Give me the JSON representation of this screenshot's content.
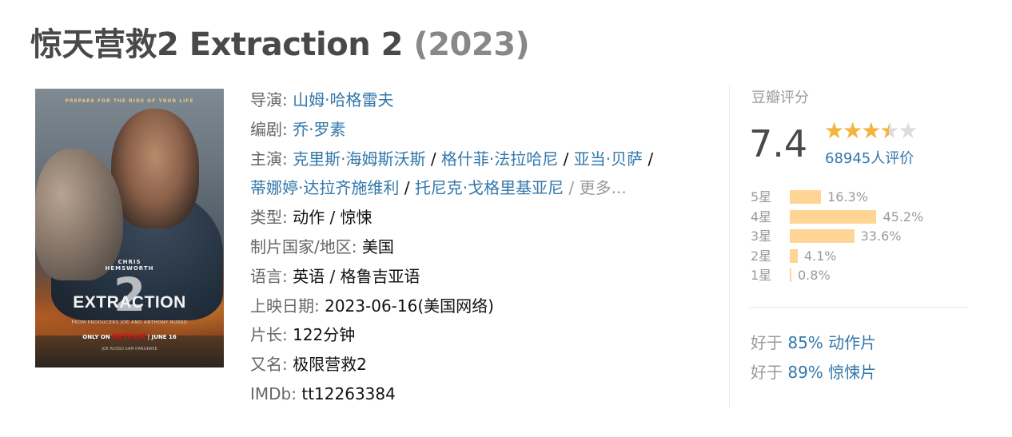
{
  "title": {
    "text": "惊天营救2 Extraction 2",
    "year": "(2023)"
  },
  "poster": {
    "tagline": "PREPARE FOR THE RIDE OF YOUR LIFE",
    "actor_line1": "CHRIS",
    "actor_line2": "HEMSWORTH",
    "big_number": "2",
    "name": "EXTRACTION",
    "credits": "FROM PRODUCERS JOE AND ANTHONY RUSSO",
    "release_prefix": "ONLY ON",
    "release_brand": "NETFLIX",
    "release_date": "JUNE 16",
    "fine_print": "JOE RUSSO   SAM HARGRAVE"
  },
  "info": {
    "director_label": "导演: ",
    "director": "山姆·哈格雷夫",
    "writer_label": "编剧: ",
    "writer": "乔·罗素",
    "cast_label": "主演: ",
    "cast": [
      "克里斯·海姆斯沃斯",
      "格什菲·法拉哈尼",
      "亚当·贝萨",
      "蒂娜婷·达拉齐施维利",
      "托尼克·戈格里基亚尼"
    ],
    "more": "更多...",
    "genre_label": "类型: ",
    "genres": [
      "动作",
      "惊悚"
    ],
    "country_label": "制片国家/地区: ",
    "country": "美国",
    "language_label": "语言: ",
    "language": "英语 / 格鲁吉亚语",
    "release_label": "上映日期: ",
    "release": "2023-06-16(美国网络)",
    "runtime_label": "片长: ",
    "runtime": "122分钟",
    "aka_label": "又名: ",
    "aka": "极限营救2",
    "imdb_label": "IMDb: ",
    "imdb": "tt12263384"
  },
  "rating": {
    "label": "豆瓣评分",
    "score": "7.4",
    "stars_value": 3.5,
    "stars_max": 5,
    "votes": "68945人评价",
    "star_color": "#f4b33a",
    "bar_color": "#ffd596",
    "distribution": [
      {
        "label": "5星",
        "percent": 16.3,
        "text": "16.3%"
      },
      {
        "label": "4星",
        "percent": 45.2,
        "text": "45.2%"
      },
      {
        "label": "3星",
        "percent": 33.6,
        "text": "33.6%"
      },
      {
        "label": "2星",
        "percent": 4.1,
        "text": "4.1%"
      },
      {
        "label": "1星",
        "percent": 0.8,
        "text": "0.8%"
      }
    ],
    "better_than": [
      {
        "prefix": "好于 ",
        "value": "85% 动作片"
      },
      {
        "prefix": "好于 ",
        "value": "89% 惊悚片"
      }
    ]
  }
}
